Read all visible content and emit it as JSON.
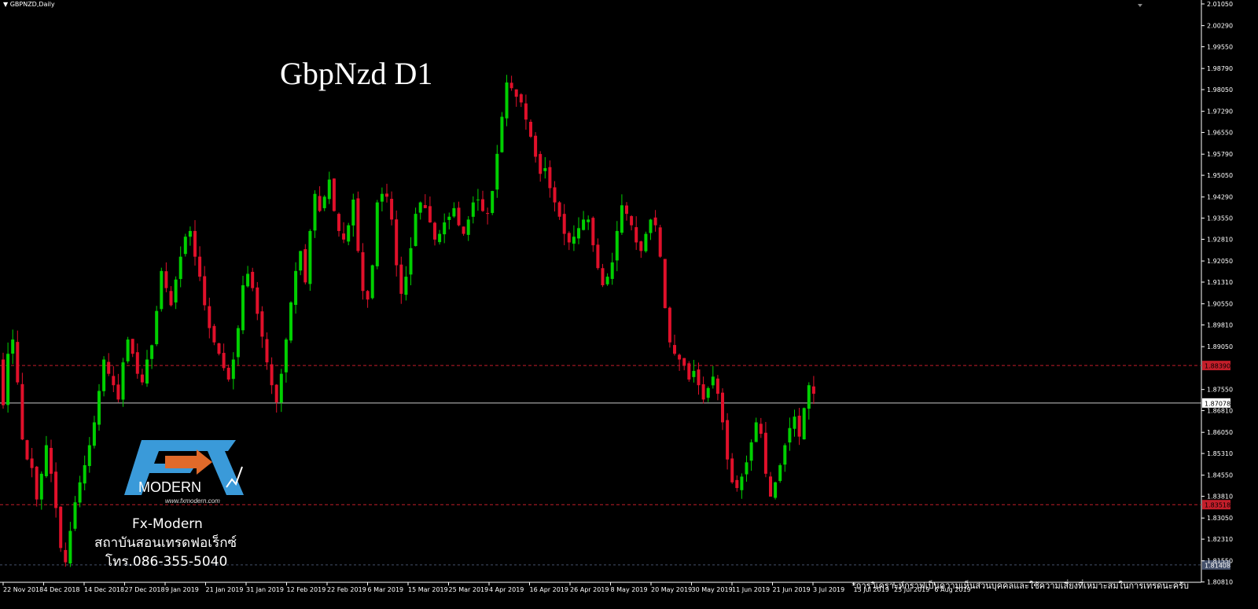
{
  "header": {
    "symbol": "GBPNZD,Daily"
  },
  "overlay": {
    "title": "GbpNzd D1",
    "brand_name": "Fx-Modern",
    "brand_line2": "สถาบันสอนเทรดฟอเร็กซ์",
    "brand_line3": "โทร.086-355-5040",
    "logo_fx": "FX",
    "logo_word": "MODERN",
    "logo_url": "www.fxmodern.com",
    "disclaimer": "*การวิเคราะห์กราฟเป็นความเห็นส่วนบุคคลและใช้ความเสี่ยงที่เหมาะสมในการเทรดนะครับ"
  },
  "colors": {
    "background": "#000000",
    "bull": "#00d000",
    "bear": "#e0102a",
    "level_line": "#c41e2a",
    "current_line": "#c8c8c8",
    "axis_text": "#ffffff",
    "logo_blue": "#3a9ad9",
    "logo_orange": "#e06a2a"
  },
  "chart_data": {
    "type": "candlestick",
    "ylim": [
      1.808,
      2.0105
    ],
    "y_ticks": [
      "2.01050",
      "2.00290",
      "1.99550",
      "1.98790",
      "1.98050",
      "1.97290",
      "1.96550",
      "1.95790",
      "1.95050",
      "1.94290",
      "1.93550",
      "1.92810",
      "1.92050",
      "1.91310",
      "1.90550",
      "1.89810",
      "1.89050",
      "1.87550",
      "1.86810",
      "1.86050",
      "1.85310",
      "1.84550",
      "1.83810",
      "1.83050",
      "1.82310",
      "1.81550",
      "1.80810"
    ],
    "x_ticks": [
      "22 Nov 2018",
      "4 Dec 2018",
      "14 Dec 2018",
      "27 Dec 2018",
      "9 Jan 2019",
      "21 Jan 2019",
      "31 Jan 2019",
      "12 Feb 2019",
      "22 Feb 2019",
      "6 Mar 2019",
      "15 Mar 2019",
      "25 Mar 2019",
      "4 Apr 2019",
      "16 Apr 2019",
      "26 Apr 2019",
      "8 May 2019",
      "20 May 2019",
      "30 May 2019",
      "11 Jun 2019",
      "21 Jun 2019",
      "3 Jul 2019",
      "15 Jul 2019",
      "25 Jul 2019",
      "6 Aug 2019"
    ],
    "price_labels": [
      {
        "value": 1.8839,
        "text": "1.88390",
        "kind": "level"
      },
      {
        "value": 1.87078,
        "text": "1.87078",
        "kind": "current"
      },
      {
        "value": 1.83518,
        "text": "1.83518",
        "kind": "level"
      },
      {
        "value": 1.81408,
        "text": "1.81408",
        "kind": "level_bottom"
      }
    ],
    "closes": [
      1.87,
      1.888,
      1.893,
      1.878,
      1.858,
      1.851,
      1.848,
      1.837,
      1.846,
      1.856,
      1.846,
      1.834,
      1.82,
      1.815,
      1.826,
      1.836,
      1.843,
      1.849,
      1.856,
      1.864,
      1.875,
      1.886,
      1.881,
      1.877,
      1.872,
      1.885,
      1.893,
      1.888,
      1.881,
      1.878,
      1.886,
      1.891,
      1.903,
      1.917,
      1.911,
      1.905,
      1.914,
      1.922,
      1.929,
      1.931,
      1.922,
      1.915,
      1.905,
      1.897,
      1.892,
      1.888,
      1.883,
      1.879,
      1.886,
      1.897,
      1.912,
      1.916,
      1.911,
      1.902,
      1.894,
      1.885,
      1.877,
      1.871,
      1.881,
      1.893,
      1.906,
      1.917,
      1.924,
      1.913,
      1.931,
      1.944,
      1.938,
      1.943,
      1.949,
      1.938,
      1.931,
      1.928,
      1.933,
      1.942,
      1.924,
      1.91,
      1.907,
      1.919,
      1.941,
      1.944,
      1.943,
      1.935,
      1.919,
      1.909,
      1.915,
      1.925,
      1.937,
      1.941,
      1.939,
      1.934,
      1.928,
      1.93,
      1.934,
      1.936,
      1.939,
      1.933,
      1.93,
      1.935,
      1.941,
      1.942,
      1.938,
      1.937,
      1.945,
      1.958,
      1.971,
      1.983,
      1.981,
      1.978,
      1.976,
      1.97,
      1.964,
      1.957,
      1.951,
      1.953,
      1.946,
      1.941,
      1.936,
      1.93,
      1.927,
      1.929,
      1.932,
      1.935,
      1.935,
      1.926,
      1.918,
      1.912,
      1.915,
      1.92,
      1.931,
      1.94,
      1.937,
      1.933,
      1.927,
      1.924,
      1.93,
      1.935,
      1.933,
      1.922,
      1.904,
      1.892,
      1.888,
      1.886,
      1.884,
      1.879,
      1.882,
      1.877,
      1.872,
      1.876,
      1.88,
      1.874,
      1.864,
      1.851,
      1.843,
      1.841,
      1.845,
      1.85,
      1.857,
      1.864,
      1.86,
      1.846,
      1.838,
      1.843,
      1.849,
      1.856,
      1.862,
      1.866,
      1.859,
      1.869,
      1.877,
      1.874
    ]
  }
}
